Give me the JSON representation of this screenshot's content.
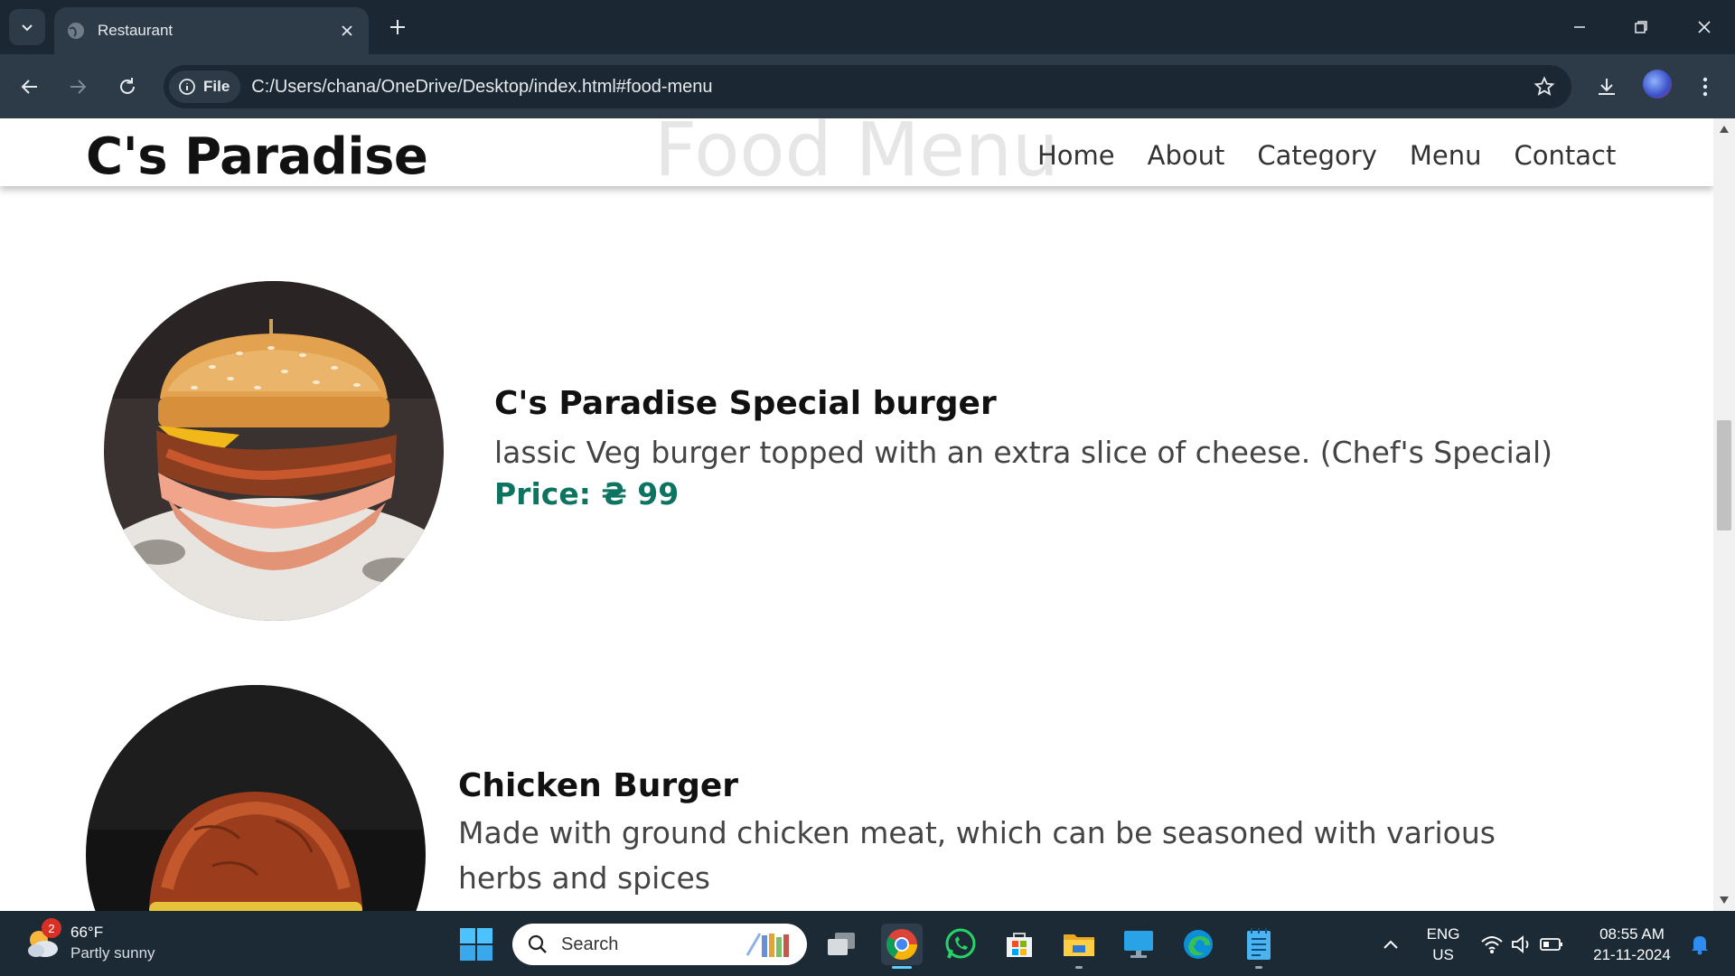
{
  "browser": {
    "tab_title": "Restaurant",
    "site_chip_label": "File",
    "url": "C:/Users/chana/OneDrive/Desktop/index.html#food-menu"
  },
  "site": {
    "logo": "C's Paradise",
    "section_heading": "Food Menu",
    "nav": [
      "Home",
      "About",
      "Category",
      "Menu",
      "Contact"
    ]
  },
  "menu_items": [
    {
      "name": "C's Paradise Special burger",
      "description": "lassic Veg burger topped with an extra slice of cheese. (Chef's Special)",
      "price": "Price: ₴ 99"
    },
    {
      "name": "Chicken Burger",
      "description": "Made with ground chicken meat, which can be seasoned with various herbs and spices"
    }
  ],
  "taskbar": {
    "weather_badge": "2",
    "temperature": "66°F",
    "condition": "Partly sunny",
    "search_placeholder": "Search",
    "lang_top": "ENG",
    "lang_bottom": "US",
    "time": "08:55 AM",
    "date": "21-11-2024"
  },
  "colors": {
    "price": "#0c7460",
    "chrome_dark": "#1b2733",
    "chrome_toolbar": "#2d3b49",
    "taskbar": "#1c2a36"
  }
}
